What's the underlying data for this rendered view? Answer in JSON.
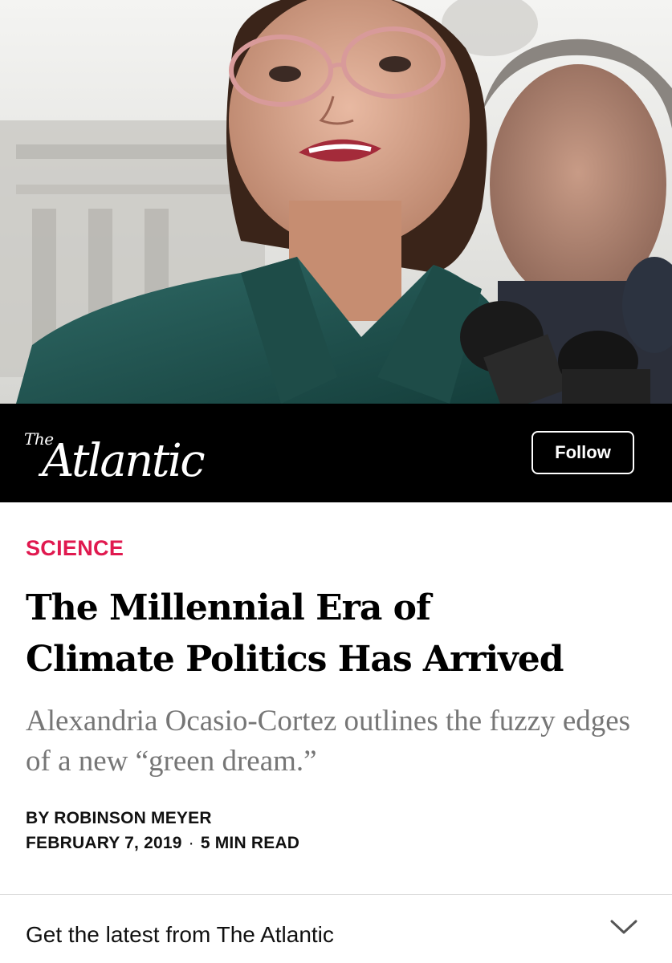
{
  "brand": {
    "logo_the": "The",
    "logo_name": "Atlantic",
    "follow_label": "Follow"
  },
  "article": {
    "section": "SCIENCE",
    "headline_line1": "The Millennial Era of",
    "headline_line2": "Climate Politics Has Arrived",
    "subheadline": "Alexandria Ocasio-Cortez outlines the fuzzy edges of a new “green dream.”",
    "byline": "BY ROBINSON MEYER",
    "date": "FEBRUARY 7, 2019",
    "separator": "·",
    "read_time": "5 MIN READ"
  },
  "footer": {
    "newsletter_label": "Get the latest from The Atlantic"
  },
  "colors": {
    "section_accent": "#e0194f",
    "brand_bar": "#000000",
    "subheadline": "#767676"
  },
  "icons": {
    "expand": "chevron-down-icon"
  }
}
